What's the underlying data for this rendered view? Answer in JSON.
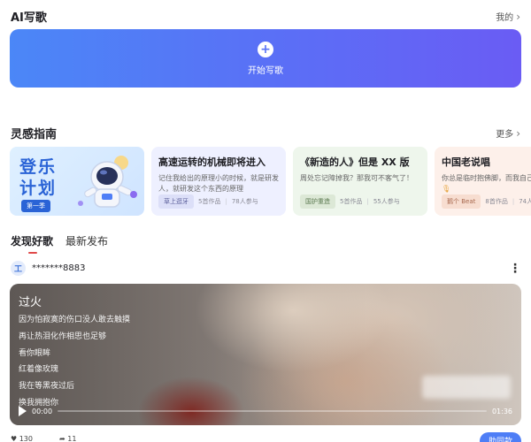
{
  "ai_write": {
    "title": "AI写歌",
    "my_link": "我的",
    "start_label": "开始写歌"
  },
  "inspiration": {
    "title": "灵感指南",
    "more_link": "更多",
    "banner": {
      "line1": "登乐",
      "line2": "计划",
      "tag": "第一季"
    },
    "cards": [
      {
        "title": "高速运转的机械即将进入",
        "desc": "记住我给出的原理小的时候，就是研发人，就研发这个东西的原理",
        "tag": "草上逛牙",
        "works": "5首作品",
        "participants": "78人参与"
      },
      {
        "title": "《新造的人》但是 XX 版",
        "desc": "周处忘记障掉我？那我可不客气了！",
        "tag": "国护重造",
        "works": "5首作品",
        "participants": "55人参与"
      },
      {
        "title": "中国老说唱",
        "desc": "你总是临时抱佛脚，而我自己",
        "tag": "鹅个 Beat",
        "works": "8首作品",
        "participants": "74人"
      }
    ]
  },
  "tabs": [
    {
      "label": "发现好歌",
      "active": true
    },
    {
      "label": "最新发布",
      "active": false
    }
  ],
  "post": {
    "username": "*******8883",
    "song": {
      "title": "过火",
      "lyrics": [
        "因为怕寂寞的伤口没人敢去触摸",
        "再让热泪化作相思也足够",
        "看你眼眸",
        "红着像玫瑰",
        "我在等黑夜过后",
        "换我拥抱你"
      ],
      "current_time": "00:00",
      "duration": "01:36",
      "progress": 0
    },
    "stats": {
      "likes": "130",
      "shares": "11"
    },
    "action_label": "助同款"
  },
  "colors": {
    "accent": "#4e7ef6",
    "hero_start": "#4b87f7",
    "hero_end": "#6a5cf4",
    "tab_indicator": "#e04a4a"
  },
  "icons": {
    "plus": "plus-icon",
    "chevron": "chevron-right-icon",
    "more": "more-vertical-icon",
    "play": "play-icon"
  }
}
